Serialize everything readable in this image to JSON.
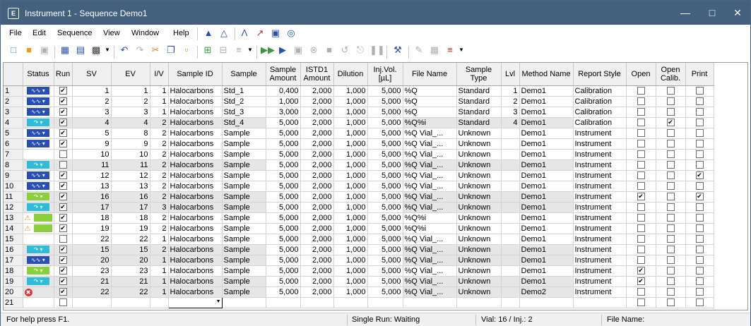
{
  "window": {
    "title": "Instrument 1 - Sequence Demo1",
    "app_icon": "document-chart-icon",
    "accent": "#44607f"
  },
  "menu": [
    "File",
    "Edit",
    "Sequence",
    "View",
    "Window",
    "Help"
  ],
  "columns": [
    "",
    "Status",
    "Run",
    "SV",
    "EV",
    "I/V",
    "Sample ID",
    "Sample",
    "Sample Amount",
    "ISTD1 Amount",
    "Dilution",
    "Inj.Vol. [µL]",
    "File Name",
    "Sample Type",
    "Lvl",
    "Method Name",
    "Report Style",
    "Open",
    "Open Calib.",
    "Print"
  ],
  "status_colors": {
    "blue": "#2a4fb4",
    "cyan": "#2fbcd6",
    "green": "#8ccf3c"
  },
  "rows": [
    {
      "n": "1",
      "status": "blue",
      "run": true,
      "sv": "1",
      "ev": "1",
      "iv": "1",
      "sid": "Halocarbons",
      "sample": "Std_1",
      "amt": "0,400",
      "istd": "2,000",
      "dil": "1,000",
      "inj": "5,000",
      "file": "%Q",
      "type": "Standard",
      "lvl": "1",
      "method": "Demo1",
      "report": "Calibration",
      "open": false,
      "calib": false,
      "print": false
    },
    {
      "n": "2",
      "status": "blue",
      "run": true,
      "sv": "2",
      "ev": "2",
      "iv": "1",
      "sid": "Halocarbons",
      "sample": "Std_2",
      "amt": "1,000",
      "istd": "2,000",
      "dil": "1,000",
      "inj": "5,000",
      "file": "%Q",
      "type": "Standard",
      "lvl": "2",
      "method": "Demo1",
      "report": "Calibration",
      "open": false,
      "calib": false,
      "print": false
    },
    {
      "n": "3",
      "status": "blue",
      "run": true,
      "sv": "3",
      "ev": "3",
      "iv": "1",
      "sid": "Halocarbons",
      "sample": "Std_3",
      "amt": "3,000",
      "istd": "2,000",
      "dil": "1,000",
      "inj": "5,000",
      "file": "%Q",
      "type": "Standard",
      "lvl": "3",
      "method": "Demo1",
      "report": "Calibration",
      "open": false,
      "calib": false,
      "print": false
    },
    {
      "n": "4",
      "status": "cyan",
      "run": true,
      "sv": "4",
      "ev": "4",
      "iv": "2",
      "sid": "Halocarbons",
      "sample": "Std_4",
      "amt": "5,000",
      "istd": "2,000",
      "dil": "1,000",
      "inj": "5,000",
      "file": "%Q%i",
      "type": "Standard",
      "lvl": "4",
      "method": "Demo1",
      "report": "Calibration",
      "open": false,
      "calib": true,
      "print": false
    },
    {
      "n": "5",
      "status": "blue",
      "run": true,
      "sv": "5",
      "ev": "8",
      "iv": "2",
      "sid": "Halocarbons",
      "sample": "Sample",
      "amt": "5,000",
      "istd": "2,000",
      "dil": "1,000",
      "inj": "5,000",
      "file": "%Q Vial_...",
      "type": "Unknown",
      "lvl": "",
      "method": "Demo1",
      "report": "Instrument",
      "open": false,
      "calib": false,
      "print": false
    },
    {
      "n": "6",
      "status": "blue",
      "run": true,
      "sv": "9",
      "ev": "9",
      "iv": "2",
      "sid": "Halocarbons",
      "sample": "Sample",
      "amt": "5,000",
      "istd": "2,000",
      "dil": "1,000",
      "inj": "5,000",
      "file": "%Q Vial_...",
      "type": "Unknown",
      "lvl": "",
      "method": "Demo1",
      "report": "Instrument",
      "open": false,
      "calib": false,
      "print": false
    },
    {
      "n": "7",
      "status": "",
      "run": false,
      "sv": "10",
      "ev": "10",
      "iv": "2",
      "sid": "Halocarbons",
      "sample": "Sample",
      "amt": "5,000",
      "istd": "2,000",
      "dil": "1,000",
      "inj": "5,000",
      "file": "%Q Vial_...",
      "type": "Unknown",
      "lvl": "",
      "method": "Demo1",
      "report": "Instrument",
      "open": false,
      "calib": false,
      "print": false
    },
    {
      "n": "8",
      "status": "cyan",
      "run": false,
      "sv": "11",
      "ev": "11",
      "iv": "2",
      "sid": "Halocarbons",
      "sample": "Sample",
      "amt": "5,000",
      "istd": "2,000",
      "dil": "1,000",
      "inj": "5,000",
      "file": "%Q Vial_...",
      "type": "Unknown",
      "lvl": "",
      "method": "Demo1",
      "report": "Instrument",
      "open": false,
      "calib": false,
      "print": false
    },
    {
      "n": "9",
      "status": "blue",
      "run": true,
      "sv": "12",
      "ev": "12",
      "iv": "2",
      "sid": "Halocarbons",
      "sample": "Sample",
      "amt": "5,000",
      "istd": "2,000",
      "dil": "1,000",
      "inj": "5,000",
      "file": "%Q Vial_...",
      "type": "Unknown",
      "lvl": "",
      "method": "Demo1",
      "report": "Instrument",
      "open": false,
      "calib": false,
      "print": true
    },
    {
      "n": "10",
      "status": "blue",
      "run": true,
      "sv": "13",
      "ev": "13",
      "iv": "2",
      "sid": "Halocarbons",
      "sample": "Sample",
      "amt": "5,000",
      "istd": "2,000",
      "dil": "1,000",
      "inj": "5,000",
      "file": "%Q Vial_...",
      "type": "Unknown",
      "lvl": "",
      "method": "Demo1",
      "report": "Instrument",
      "open": false,
      "calib": false,
      "print": false
    },
    {
      "n": "11",
      "status": "green",
      "run": true,
      "sv": "16",
      "ev": "16",
      "iv": "2",
      "sid": "Halocarbons",
      "sample": "Sample",
      "amt": "5,000",
      "istd": "2,000",
      "dil": "1,000",
      "inj": "5,000",
      "file": "%Q Vial_...",
      "type": "Unknown",
      "lvl": "",
      "method": "Demo1",
      "report": "Instrument",
      "open": true,
      "calib": false,
      "print": true
    },
    {
      "n": "12",
      "status": "cyan",
      "run": true,
      "sv": "17",
      "ev": "17",
      "iv": "3",
      "sid": "Halocarbons",
      "sample": "Sample",
      "amt": "5,000",
      "istd": "2,000",
      "dil": "1,000",
      "inj": "5,000",
      "file": "%Q Vial_...",
      "type": "Unknown",
      "lvl": "",
      "method": "Demo1",
      "report": "Instrument",
      "open": false,
      "calib": false,
      "print": false
    },
    {
      "n": "13",
      "status": "warn",
      "run": true,
      "sv": "18",
      "ev": "18",
      "iv": "2",
      "sid": "Halocarbons",
      "sample": "Sample",
      "amt": "5,000",
      "istd": "2,000",
      "dil": "1,000",
      "inj": "5,000",
      "file": "%Q%i",
      "type": "Unknown",
      "lvl": "",
      "method": "Demo1",
      "report": "Instrument",
      "open": false,
      "calib": false,
      "print": false
    },
    {
      "n": "14",
      "status": "warn",
      "run": true,
      "sv": "19",
      "ev": "19",
      "iv": "2",
      "sid": "Halocarbons",
      "sample": "Sample",
      "amt": "5,000",
      "istd": "2,000",
      "dil": "1,000",
      "inj": "5,000",
      "file": "%Q%i",
      "type": "Unknown",
      "lvl": "",
      "method": "Demo1",
      "report": "Instrument",
      "open": false,
      "calib": false,
      "print": false
    },
    {
      "n": "15",
      "status": "",
      "run": false,
      "sv": "22",
      "ev": "22",
      "iv": "1",
      "sid": "Halocarbons",
      "sample": "Sample",
      "amt": "5,000",
      "istd": "2,000",
      "dil": "1,000",
      "inj": "5,000",
      "file": "%Q Vial_...",
      "type": "Unknown",
      "lvl": "",
      "method": "Demo1",
      "report": "Instrument",
      "open": false,
      "calib": false,
      "print": false
    },
    {
      "n": "16",
      "status": "cyan",
      "run": true,
      "sv": "15",
      "ev": "15",
      "iv": "2",
      "sid": "Halocarbons",
      "sample": "Sample",
      "amt": "5,000",
      "istd": "2,000",
      "dil": "1,000",
      "inj": "5,000",
      "file": "%Q Vial_...",
      "type": "Unknown",
      "lvl": "",
      "method": "Demo1",
      "report": "Instrument",
      "open": false,
      "calib": false,
      "print": false
    },
    {
      "n": "17",
      "status": "blue",
      "run": true,
      "sv": "20",
      "ev": "20",
      "iv": "1",
      "sid": "Halocarbons",
      "sample": "Sample",
      "amt": "5,000",
      "istd": "2,000",
      "dil": "1,000",
      "inj": "5,000",
      "file": "%Q Vial_...",
      "type": "Unknown",
      "lvl": "",
      "method": "Demo1",
      "report": "Instrument",
      "open": false,
      "calib": false,
      "print": false
    },
    {
      "n": "18",
      "status": "green",
      "run": true,
      "sv": "23",
      "ev": "23",
      "iv": "1",
      "sid": "Halocarbons",
      "sample": "Sample",
      "amt": "5,000",
      "istd": "2,000",
      "dil": "1,000",
      "inj": "5,000",
      "file": "%Q Vial_...",
      "type": "Unknown",
      "lvl": "",
      "method": "Demo1",
      "report": "Instrument",
      "open": true,
      "calib": false,
      "print": false
    },
    {
      "n": "19",
      "status": "cyan",
      "run": true,
      "sv": "21",
      "ev": "21",
      "iv": "1",
      "sid": "Halocarbons",
      "sample": "Sample",
      "amt": "5,000",
      "istd": "2,000",
      "dil": "1,000",
      "inj": "5,000",
      "file": "%Q Vial_...",
      "type": "Unknown",
      "lvl": "",
      "method": "Demo1",
      "report": "Instrument",
      "open": true,
      "calib": false,
      "print": false
    },
    {
      "n": "20",
      "status": "error",
      "run": true,
      "sv": "22",
      "ev": "22",
      "iv": "1",
      "sid": "Halocarbons",
      "sample": "Sample",
      "amt": "5,000",
      "istd": "2,000",
      "dil": "1,000",
      "inj": "5,000",
      "file": "%Q Vial_...",
      "type": "Unknown",
      "lvl": "",
      "method": "Demo2",
      "report": "Instrument",
      "open": false,
      "calib": false,
      "print": false
    }
  ],
  "new_row": {
    "n": "21"
  },
  "statusbar": {
    "help": "For help press F1.",
    "run": "Single Run: Waiting",
    "vial": "Vial: 16 / Inj.: 2",
    "file": "File Name:"
  }
}
